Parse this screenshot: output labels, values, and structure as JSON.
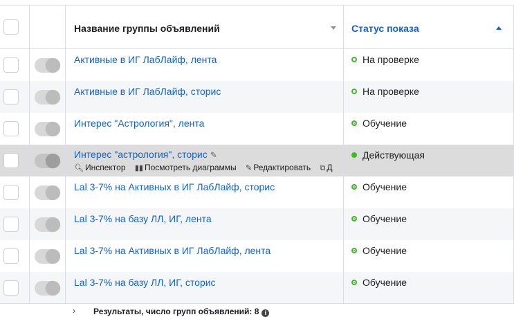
{
  "header": {
    "name_column": "Название группы объявлений",
    "status_column": "Статус показа"
  },
  "rows": [
    {
      "name": "Активные в ИГ ЛабЛайф, лента",
      "status": "На проверке",
      "status_kind": "ring"
    },
    {
      "name": "Активные в ИГ ЛабЛайф, сторис",
      "status": "На проверке",
      "status_kind": "ring"
    },
    {
      "name": "Интерес \"Астрология\", лента",
      "status": "Обучение",
      "status_kind": "target"
    },
    {
      "name": "Интерес \"астрология\", сторис",
      "status": "Действующая",
      "status_kind": "solid"
    },
    {
      "name": "Lal 3-7% на Активных в ИГ ЛабЛайф, сторис",
      "status": "Обучение",
      "status_kind": "target"
    },
    {
      "name": "Lal 3-7% на базу ЛЛ, ИГ, лента",
      "status": "Обучение",
      "status_kind": "target"
    },
    {
      "name": "Lal 3-7% на Активных в ИГ ЛабЛайф, лента",
      "status": "Обучение",
      "status_kind": "target"
    },
    {
      "name": "Lal 3-7% на базу ЛЛ, ИГ, сторис",
      "status": "Обучение",
      "status_kind": "target"
    }
  ],
  "row_actions": {
    "inspector": "Инспектор",
    "view_charts": "Посмотреть диаграммы",
    "edit": "Редактировать",
    "duplicate": "Д"
  },
  "footer": {
    "results": "Результаты, число групп объявлений: 8"
  },
  "colors": {
    "link": "#1264c3",
    "status_green": "#42b72a",
    "hover_row": "#dcdcdc",
    "alt_row": "#f5f6f7"
  }
}
